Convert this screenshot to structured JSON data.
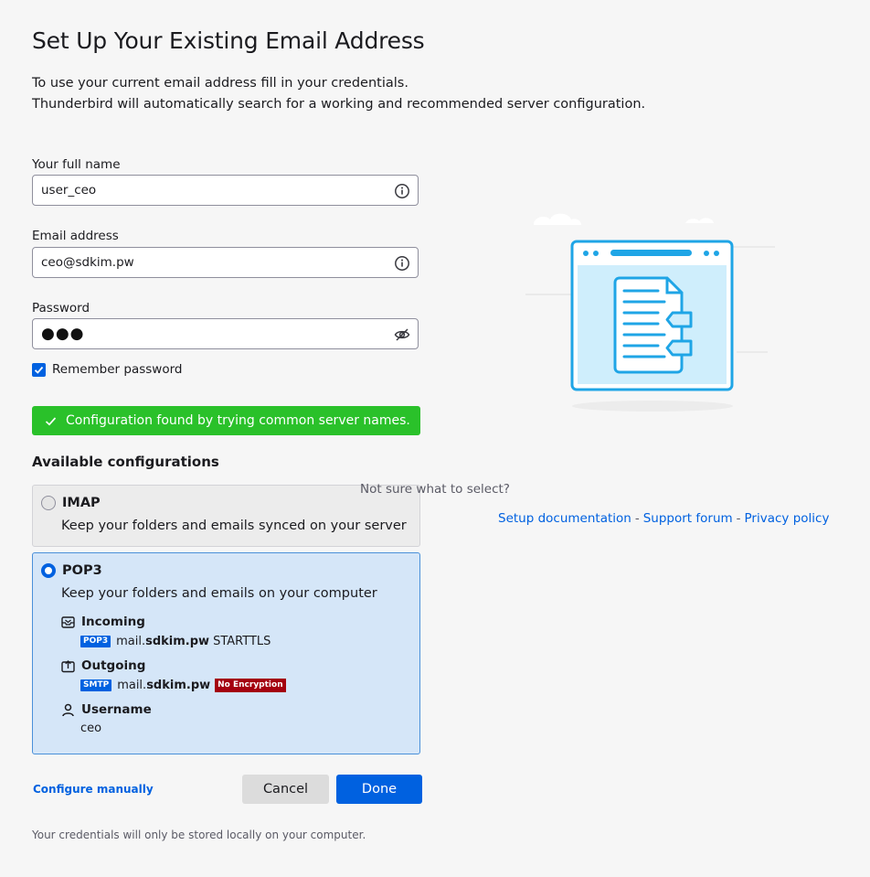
{
  "header": {
    "title": "Set Up Your Existing Email Address",
    "intro_line1": "To use your current email address fill in your credentials.",
    "intro_line2": "Thunderbird will automatically search for a working and recommended server configuration."
  },
  "form": {
    "fullname": {
      "label": "Your full name",
      "value": "user_ceo",
      "icon": "info-icon"
    },
    "email": {
      "label": "Email address",
      "value": "ceo@sdkim.pw",
      "icon": "info-icon"
    },
    "password": {
      "label": "Password",
      "masked_value": "●●●",
      "icon": "eye-slash-icon"
    },
    "remember": {
      "label": "Remember password",
      "checked": true
    }
  },
  "status": {
    "message": "Configuration found by trying common server names.",
    "color": "#2ac12a"
  },
  "configs": {
    "title": "Available configurations",
    "imap": {
      "name": "IMAP",
      "description": "Keep your folders and emails synced on your server",
      "selected": false
    },
    "pop3": {
      "name": "POP3",
      "description": "Keep your folders and emails on your computer",
      "selected": true,
      "incoming": {
        "label": "Incoming",
        "protocol": "POP3",
        "host_prefix": "mail.",
        "host_domain": "sdkim.pw",
        "security": "STARTTLS"
      },
      "outgoing": {
        "label": "Outgoing",
        "protocol": "SMTP",
        "host_prefix": "mail.",
        "host_domain": "sdkim.pw",
        "security_badge": "No Encryption"
      },
      "username": {
        "label": "Username",
        "value": "ceo"
      }
    }
  },
  "actions": {
    "configure_manually": "Configure manually",
    "cancel": "Cancel",
    "done": "Done"
  },
  "footer": {
    "note": "Your credentials will only be stored locally on your computer."
  },
  "help": {
    "question": "Not sure what to select?",
    "links": {
      "setup_docs": "Setup documentation",
      "support_forum": "Support forum",
      "privacy_policy": "Privacy policy"
    },
    "separator": "-"
  },
  "colors": {
    "accent": "#0061e0",
    "success": "#2ac12a",
    "danger": "#a4000f",
    "selected_bg": "#d5e6f8"
  }
}
